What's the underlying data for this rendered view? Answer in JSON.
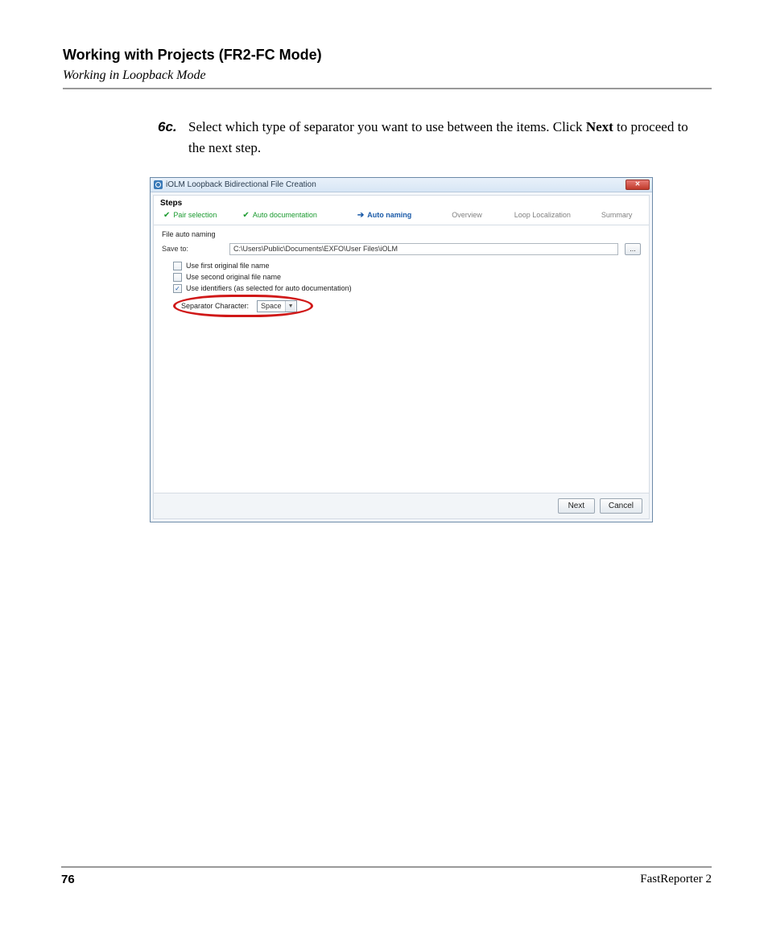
{
  "page": {
    "title": "Working with Projects (FR2-FC Mode)",
    "subtitle": "Working in Loopback Mode",
    "number": "76",
    "product": "FastReporter 2"
  },
  "instruction": {
    "num": "6c.",
    "text_a": "Select which type of separator you want to use between the items. Click ",
    "bold": "Next",
    "text_b": " to proceed to the next step."
  },
  "dialog": {
    "title": "iOLM Loopback Bidirectional File Creation",
    "close_glyph": "✕",
    "steps_label": "Steps",
    "steps": {
      "pair_selection": "Pair selection",
      "auto_documentation": "Auto documentation",
      "auto_naming": "Auto naming",
      "overview": "Overview",
      "loop_localization": "Loop Localization",
      "summary": "Summary"
    },
    "section_heading": "File auto naming",
    "save_to_label": "Save to:",
    "save_to_value": "C:\\Users\\Public\\Documents\\EXFO\\User Files\\iOLM",
    "browse_label": "...",
    "cb1": "Use first original file name",
    "cb2": "Use second original file name",
    "cb3": "Use identifiers (as selected for auto documentation)",
    "cb3_check": "✓",
    "separator_label": "Separator Character:",
    "separator_value": "Space",
    "caret": "▼",
    "next": "Next",
    "cancel": "Cancel"
  }
}
